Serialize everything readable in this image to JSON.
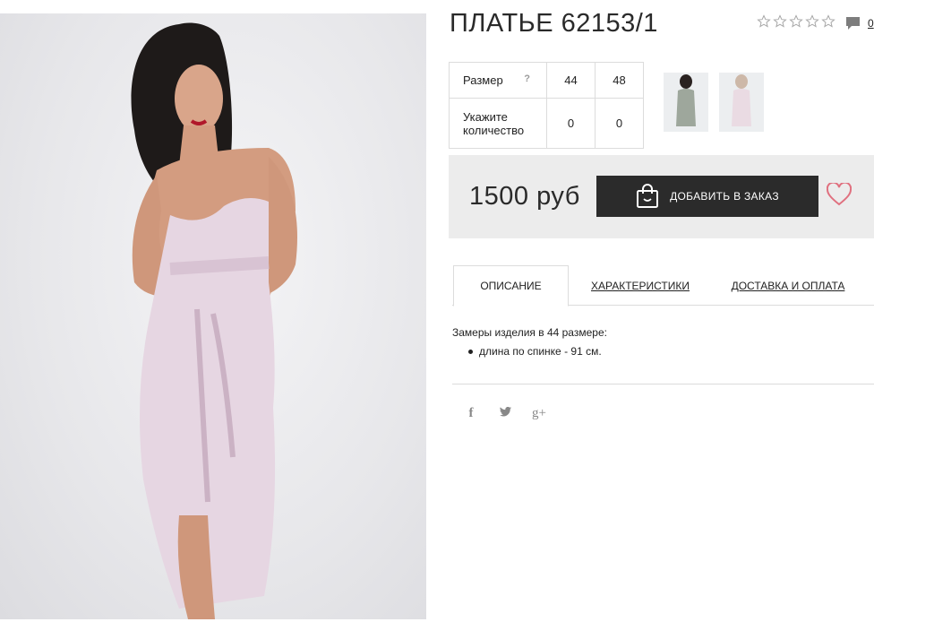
{
  "product": {
    "title": "ПЛАТЬЕ 62153/1",
    "rating_stars": 5,
    "rating_value": 0,
    "reviews_count": "0"
  },
  "sizes": {
    "size_label": "Размер",
    "help": "?",
    "quantity_label_1": "Укажите",
    "quantity_label_2": "количество",
    "columns": [
      {
        "size": "44",
        "qty": "0"
      },
      {
        "size": "48",
        "qty": "0"
      }
    ]
  },
  "thumbnails": [
    "model-photo-sage-dress",
    "model-photo-pink-dress"
  ],
  "buy": {
    "price": "1500 руб",
    "add_button": "ДОБАВИТЬ В ЗАКАЗ",
    "wishlist_icon": "heart-icon"
  },
  "tabs": [
    {
      "label": "ОПИСАНИЕ",
      "active": true
    },
    {
      "label": "ХАРАКТЕРИСТИКИ",
      "active": false
    },
    {
      "label": "ДОСТАВКА И ОПЛАТА",
      "active": false
    }
  ],
  "description": {
    "intro": "Замеры изделия в 44 размере:",
    "items": [
      "длина по спинке - 91 см."
    ]
  },
  "social": [
    {
      "icon": "facebook-icon",
      "glyph": "f"
    },
    {
      "icon": "twitter-icon",
      "glyph": "🐦"
    },
    {
      "icon": "google-plus-icon",
      "glyph": "g+"
    }
  ],
  "colors": {
    "button_bg": "#2b2b2b",
    "panel_bg": "#ececec",
    "heart": "#e0707f",
    "dress": "#e6d6e2"
  }
}
